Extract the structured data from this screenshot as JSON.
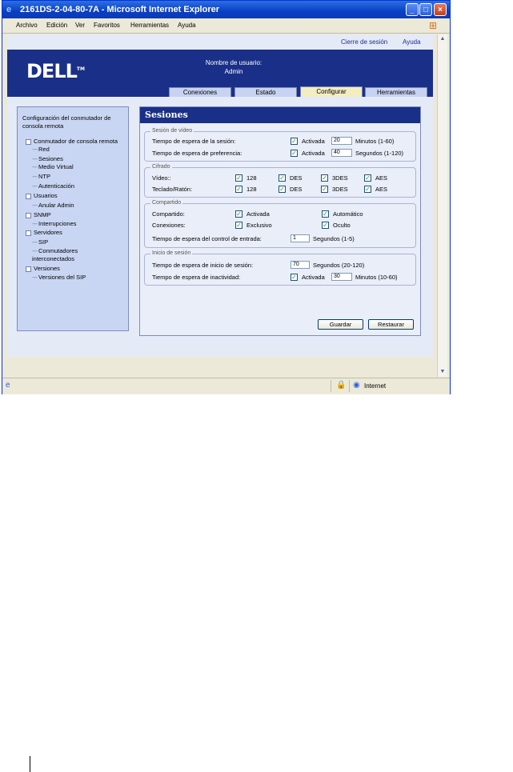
{
  "window": {
    "title": "2161DS-2-04-80-7A - Microsoft Internet Explorer",
    "min_glyph": "_",
    "max_glyph": "□",
    "close_glyph": "×"
  },
  "menu": [
    "Archivo",
    "Edición",
    "Ver",
    "Favoritos",
    "Herramientas",
    "Ayuda"
  ],
  "top_links": {
    "logout": "Cierre de sesión",
    "help": "Ayuda"
  },
  "brand": "DELL",
  "brand_tm": "TM",
  "user": {
    "label": "Nombre de usuario:",
    "name": "Admin"
  },
  "tabs": [
    {
      "label": "Conexiones",
      "active": false
    },
    {
      "label": "Estado",
      "active": false
    },
    {
      "label": "Configurar",
      "active": true
    },
    {
      "label": "Herramientas",
      "active": false
    }
  ],
  "sidebar": {
    "title": "Configuración del conmutador de consola remota",
    "tree": [
      {
        "label": "Conmutador de consola remota",
        "level": 0
      },
      {
        "label": "Red",
        "level": 1
      },
      {
        "label": "Sesiones",
        "level": 1
      },
      {
        "label": "Medio Virtual",
        "level": 1
      },
      {
        "label": "NTP",
        "level": 1
      },
      {
        "label": "Autenticación",
        "level": 1
      },
      {
        "label": "Usuarios",
        "level": 0
      },
      {
        "label": "Anular Admin",
        "level": 1
      },
      {
        "label": "SNMP",
        "level": 0
      },
      {
        "label": "Interrupciones",
        "level": 1
      },
      {
        "label": "Servidores",
        "level": 0
      },
      {
        "label": "SIP",
        "level": 1
      },
      {
        "label": "Conmutadores interconectados",
        "level": 1
      },
      {
        "label": "Versiones",
        "level": 0
      },
      {
        "label": "Versiones del SIP",
        "level": 1
      }
    ]
  },
  "panel": {
    "title": "Sesiones",
    "video": {
      "legend": "Sesión de vídeo",
      "timeout_label": "Tiempo de espera de la sesión:",
      "timeout_enabled_label": "Activada",
      "timeout_value": "20",
      "timeout_units": "Minutos (1-60)",
      "preempt_label": "Tiempo de espera de preferencia:",
      "preempt_enabled_label": "Activada",
      "preempt_value": "40",
      "preempt_units": "Segundos (1-120)"
    },
    "encryption": {
      "legend": "Cifrado",
      "video_label": "Vídeo::",
      "kb_label": "Teclado/Ratón:",
      "options": [
        "128",
        "DES",
        "3DES",
        "AES"
      ]
    },
    "sharing": {
      "legend": "Compartido",
      "shared_label": "Compartido:",
      "enabled_label": "Activada",
      "automatic_label": "Automático",
      "connections_label": "Conexiones:",
      "exclusive_label": "Exclusivo",
      "hidden_label": "Oculto",
      "input_timeout_label": "Tiempo de espera del control de entrada:",
      "input_timeout_value": "1",
      "input_timeout_units": "Segundos (1-5)"
    },
    "login": {
      "legend": "Inicio de sesión",
      "login_timeout_label": "Tiempo de espera de inicio de sesión:",
      "login_timeout_value": "70",
      "login_timeout_units": "Segundos (20-120)",
      "inactivity_label": "Tiempo de espera de inactividad:",
      "inactivity_enabled_label": "Activada",
      "inactivity_value": "30",
      "inactivity_units": "Minutos (10-60)"
    },
    "save": "Guardar",
    "reset": "Restaurar"
  },
  "checkmark": "✓",
  "status": {
    "zone": "Internet"
  },
  "colors": {
    "navy": "#1a2f87",
    "panel_bg": "#c9d6f3",
    "active_tab": "#f3eec0"
  }
}
